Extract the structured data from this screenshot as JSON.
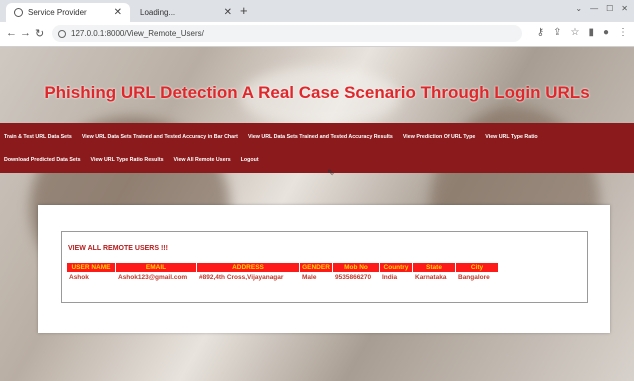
{
  "browser": {
    "tabs": [
      {
        "title": "Service Provider"
      },
      {
        "title": "Loading..."
      }
    ],
    "new_tab": "+",
    "url": "127.0.0.1:8000/View_Remote_Users/"
  },
  "page": {
    "title": "Phishing URL Detection A Real Case Scenario Through Login URLs",
    "menu_row1": [
      "Train & Test URL Data Sets",
      "View URL Data Sets Trained and Tested Accuracy in Bar Chart",
      "View URL Data Sets Trained and Tested Accuracy Results",
      "View Prediction Of URL Type",
      "View URL Type Ratio"
    ],
    "menu_row2": [
      "Download Predicted Data Sets",
      "View URL Type Ratio Results",
      "View All Remote Users",
      "Logout"
    ],
    "users_title": "VIEW ALL REMOTE USERS !!!",
    "table": {
      "headers": [
        "USER NAME",
        "EMAIL",
        "ADDRESS",
        "GENDER",
        "Mob No",
        "Country",
        "State",
        "City"
      ],
      "rows": [
        [
          "Ashok",
          "Ashok123@gmail.com",
          "#892,4th Cross,Vijayanagar",
          "Male",
          "9535866270",
          "India",
          "Karnataka",
          "Bangalore"
        ]
      ]
    }
  }
}
